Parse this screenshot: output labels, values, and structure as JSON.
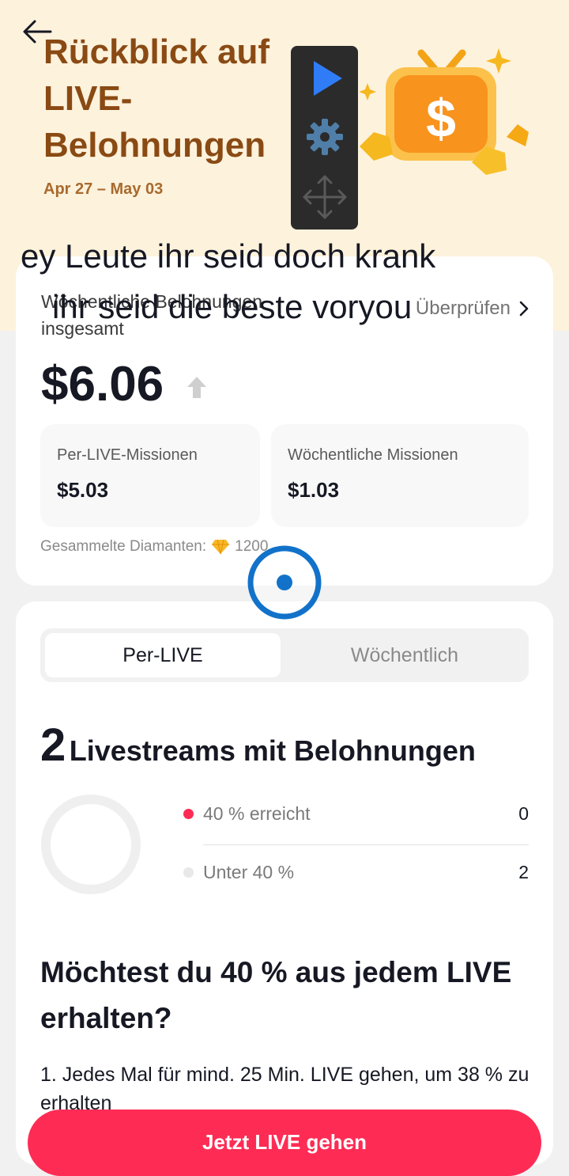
{
  "header": {
    "title": "Rückblick auf LIVE-Belohnungen",
    "date_range": "Apr 27 – May 03"
  },
  "overlay": {
    "line1": "ey Leute ihr seid doch krank",
    "line2": "ihr seid die beste voryou"
  },
  "summary": {
    "weekly_label": "Wöchentliche Belohnungen insgesamt",
    "check_label": "Überprüfen",
    "total": "$6.06",
    "per_live_label": "Per-LIVE-Missionen",
    "per_live_value": "$5.03",
    "weekly_missions_label": "Wöchentliche Missionen",
    "weekly_missions_value": "$1.03",
    "diamonds_label": "Gesammelte Diamanten:",
    "diamonds_value": "1200"
  },
  "tabs": [
    "Per-LIVE",
    "Wöchentlich"
  ],
  "streams": {
    "count": "2",
    "label": "Livestreams mit Belohnungen",
    "legend": [
      {
        "label": "40 % erreicht",
        "value": "0",
        "color": "#fe2c55"
      },
      {
        "label": "Unter 40 %",
        "value": "2",
        "color": "#e8e8e8"
      }
    ]
  },
  "tips": {
    "heading": "Möchtest du 40 % aus jedem LIVE erhalten?",
    "tip1": "1. Jedes Mal für mind. 25 Min. LIVE gehen, um 38 % zu erhalten"
  },
  "cta_label": "Jetzt LIVE gehen",
  "colors": {
    "accent": "#fe2c55",
    "hero_bg": "#fdf2dc",
    "title_brown": "#8a4a14"
  }
}
